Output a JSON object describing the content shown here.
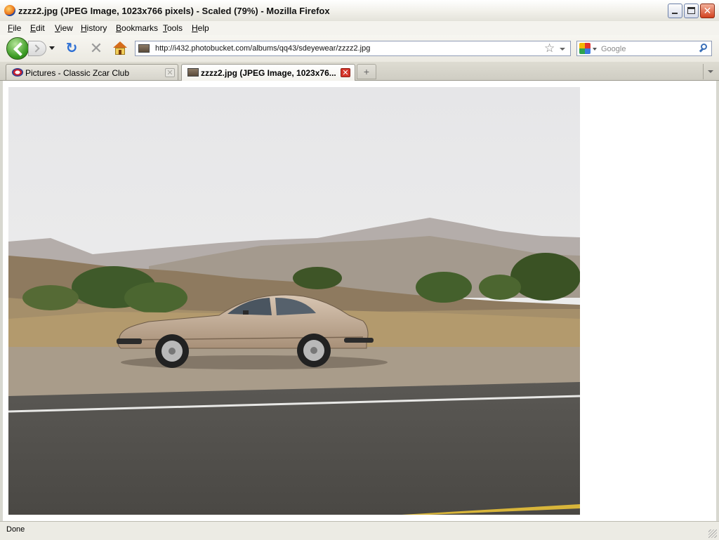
{
  "window": {
    "title": "zzzz2.jpg (JPEG Image, 1023x766 pixels) - Scaled (79%) - Mozilla Firefox",
    "minimize_glyph": "",
    "maximize_glyph": "",
    "close_glyph": "✕"
  },
  "menu": [
    {
      "key": "F",
      "rest": "ile"
    },
    {
      "key": "E",
      "rest": "dit"
    },
    {
      "key": "V",
      "rest": "iew"
    },
    {
      "key": "H",
      "rest": "istory",
      "pre": ""
    },
    {
      "key": "B",
      "rest": "ookmarks"
    },
    {
      "key": "T",
      "rest": "ools"
    },
    {
      "key": "H",
      "rest": "elp"
    }
  ],
  "navigation": {
    "reload_glyph": "↻",
    "stop_glyph": "✕",
    "url": "http://i432.photobucket.com/albums/qq43/sdeyewear/zzzz2.jpg",
    "bookmark_glyph": "☆",
    "search_placeholder": "Google",
    "search_value": ""
  },
  "tabs": [
    {
      "label": "Pictures - Classic Zcar Club",
      "close": "✕"
    },
    {
      "label": "zzzz2.jpg (JPEG Image, 1023x76...",
      "close": "✕"
    }
  ],
  "new_tab_glyph": "+",
  "status": {
    "text": "Done"
  },
  "colors": {
    "accent": "#2d6fd4",
    "back_button": "#3a9a22",
    "close_button": "#d2411e"
  }
}
